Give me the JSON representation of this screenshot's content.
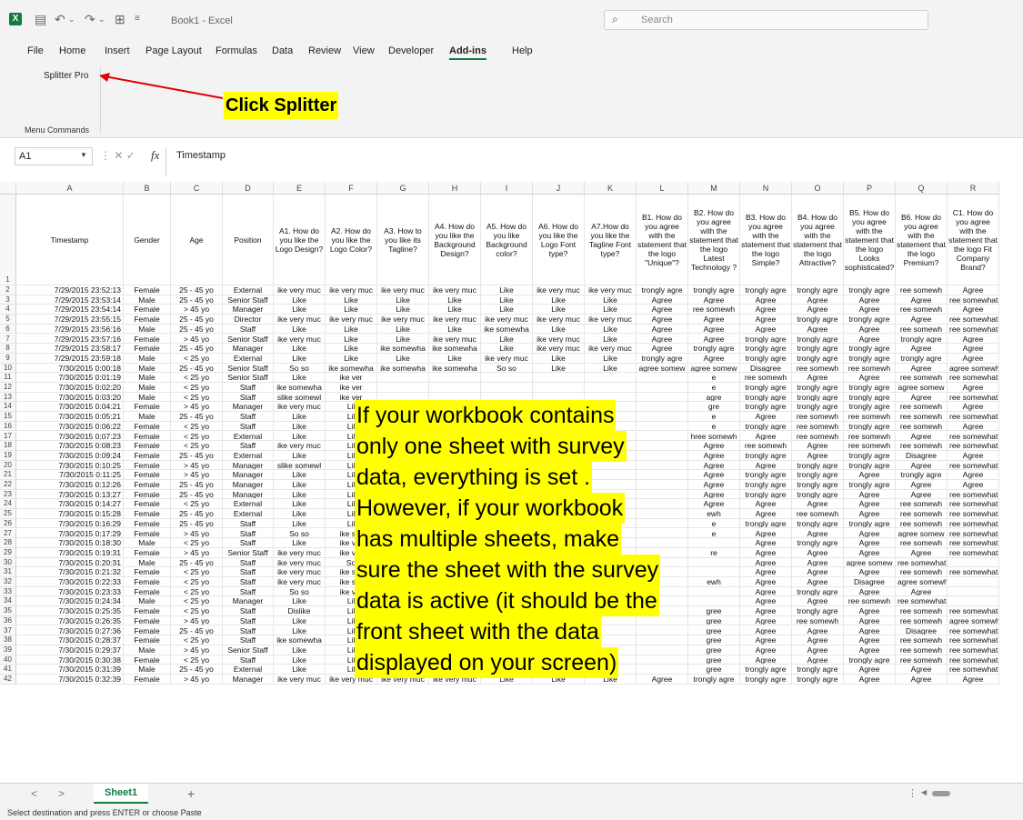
{
  "window": {
    "app_logo": "X",
    "title": "Book1 - Excel",
    "search_placeholder": "Search"
  },
  "menu": [
    "File",
    "Home",
    "Insert",
    "Page Layout",
    "Formulas",
    "Data",
    "Review",
    "View",
    "Developer",
    "Add-ins",
    "Help"
  ],
  "menu_active": "Add-ins",
  "ribbon": {
    "button": "Splitter Pro",
    "group": "Menu Commands"
  },
  "annotation": {
    "small": "Click Splitter",
    "big_lines": [
      "If your workbook contains",
      "only one sheet with survey",
      "data, everything is set .",
      "However, if your workbook",
      "has multiple sheets, make",
      "sure the sheet with the survey",
      "data is active (it should be the",
      "front sheet with the data",
      "displayed on your screen)"
    ]
  },
  "formula_bar": {
    "name_box": "A1",
    "fx": "fx",
    "content": "Timestamp"
  },
  "grid": {
    "columns": [
      "A",
      "B",
      "C",
      "D",
      "E",
      "F",
      "G",
      "H",
      "I",
      "J",
      "K",
      "L",
      "M",
      "N",
      "O",
      "P",
      "Q",
      "R"
    ],
    "header_row": [
      "Timestamp",
      "Gender",
      "Age",
      "Position",
      "A1. How do you like the Logo Design?",
      "A2. How do you like the Logo Color?",
      "A3. How to you like its Tagline?",
      "A4. How do you like the Background Design?",
      "A5. How do you like Background color?",
      "A6. How do you like the Logo Font type?",
      "A7.How do you like the Tagline Font type?",
      "B1. How do you agree with the statement that the logo \"Unique\"?",
      "B2. How do you agree with the statement that the logo Latest Technology ?",
      "B3. How do you agree with the statement that the logo Simple?",
      "B4. How do you agree with the statement that the logo Attractive?",
      "B5. How do you agree with the statement that the logo Looks sophisticated?",
      "B6. How do you agree with the statement that the logo Premium?",
      "C1. How do you agree with the statement that the logo Fit Company Brand?"
    ],
    "rows": [
      [
        "7/29/2015 23:52:13",
        "Female",
        "25 - 45 yo",
        "External",
        "ike very muc",
        "ike very muc",
        "ike very muc",
        "ike very muc",
        "Like",
        "ike very muc",
        "ike very muc",
        "trongly agre",
        "trongly agre",
        "trongly agre",
        "trongly agre",
        "trongly agre",
        "ree somewh",
        "Agree"
      ],
      [
        "7/29/2015 23:53:14",
        "Male",
        "25 - 45 yo",
        "Senior Staff",
        "Like",
        "Like",
        "Like",
        "Like",
        "Like",
        "Like",
        "Like",
        "Agree",
        "Agree",
        "Agree",
        "Agree",
        "Agree",
        "Agree",
        "ree somewhat"
      ],
      [
        "7/29/2015 23:54:14",
        "Female",
        "> 45 yo",
        "Manager",
        "Like",
        "Like",
        "Like",
        "Like",
        "Like",
        "Like",
        "Like",
        "Agree",
        "ree somewh",
        "Agree",
        "Agree",
        "Agree",
        "ree somewh",
        "Agree"
      ],
      [
        "7/29/2015 23:55:15",
        "Female",
        "25 - 45 yo",
        "Director",
        "ike very muc",
        "ike very muc",
        "ike very muc",
        "ike very muc",
        "ike very muc",
        "ike very muc",
        "ike very muc",
        "Agree",
        "Agree",
        "Agree",
        "trongly agre",
        "trongly agre",
        "Agree",
        "ree somewhat"
      ],
      [
        "7/29/2015 23:56:16",
        "Male",
        "25 - 45 yo",
        "Staff",
        "Like",
        "Like",
        "Like",
        "Like",
        "ike somewha",
        "Like",
        "Like",
        "Agree",
        "Agree",
        "Agree",
        "Agree",
        "Agree",
        "ree somewh",
        "ree somewhat"
      ],
      [
        "7/29/2015 23:57:16",
        "Female",
        "> 45 yo",
        "Senior Staff",
        "ike very muc",
        "Like",
        "Like",
        "ike very muc",
        "Like",
        "ike very muc",
        "Like",
        "Agree",
        "Agree",
        "trongly agre",
        "trongly agre",
        "Agree",
        "trongly agre",
        "Agree"
      ],
      [
        "7/29/2015 23:58:17",
        "Female",
        "25 - 45 yo",
        "Manager",
        "Like",
        "Like",
        "ike somewha",
        "ike somewha",
        "Like",
        "ike very muc",
        "ike very muc",
        "Agree",
        "trongly agre",
        "trongly agre",
        "trongly agre",
        "trongly agre",
        "Agree",
        "Agree"
      ],
      [
        "7/29/2015 23:59:18",
        "Male",
        "< 25 yo",
        "External",
        "Like",
        "Like",
        "Like",
        "Like",
        "ike very muc",
        "Like",
        "Like",
        "trongly agre",
        "Agree",
        "trongly agre",
        "trongly agre",
        "trongly agre",
        "trongly agre",
        "Agree"
      ],
      [
        "7/30/2015 0:00:18",
        "Male",
        "25 - 45 yo",
        "Senior Staff",
        "So so",
        "ike somewha",
        "ike somewha",
        "ike somewha",
        "So so",
        "Like",
        "Like",
        "agree somew",
        "agree somew",
        "Disagree",
        "ree somewh",
        "ree somewh",
        "Agree",
        "agree somewhat"
      ],
      [
        "7/30/2015 0:01:19",
        "Male",
        "< 25 yo",
        "Senior Staff",
        "Like",
        "ike ver",
        "",
        "",
        "",
        "",
        "",
        "",
        "e",
        "ree somewh",
        "Agree",
        "Agree",
        "ree somewh",
        "ree somewhat"
      ],
      [
        "7/30/2015 0:02:20",
        "Male",
        "< 25 yo",
        "Staff",
        "ike somewha",
        "ike ver",
        "",
        "",
        "",
        "",
        "",
        "",
        "e",
        "trongly agre",
        "trongly agre",
        "trongly agre",
        "agree somew",
        "Agree"
      ],
      [
        "7/30/2015 0:03:20",
        "Male",
        "< 25 yo",
        "Staff",
        "slike somewl",
        "ike ver",
        "",
        "",
        "",
        "",
        "",
        "",
        "agre",
        "trongly agre",
        "trongly agre",
        "trongly agre",
        "Agree",
        "ree somewhat"
      ],
      [
        "7/30/2015 0:04:21",
        "Female",
        "> 45 yo",
        "Manager",
        "ike very muc",
        "Lil",
        "",
        "",
        "",
        "",
        "",
        "",
        "gre",
        "trongly agre",
        "trongly agre",
        "trongly agre",
        "ree somewh",
        "Agree"
      ],
      [
        "7/30/2015 0:05:21",
        "Male",
        "25 - 45 yo",
        "Staff",
        "Like",
        "Lil",
        "",
        "",
        "",
        "",
        "",
        "",
        "e",
        "Agree",
        "ree somewh",
        "ree somewh",
        "ree somewh",
        "ree somewhat"
      ],
      [
        "7/30/2015 0:06:22",
        "Female",
        "< 25 yo",
        "Staff",
        "Like",
        "Lil",
        "",
        "",
        "",
        "",
        "",
        "",
        "e",
        "trongly agre",
        "ree somewh",
        "trongly agre",
        "ree somewh",
        "Agree"
      ],
      [
        "7/30/2015 0:07:23",
        "Female",
        "< 25 yo",
        "External",
        "Like",
        "Lil",
        "",
        "",
        "",
        "",
        "",
        "",
        "hree somewh",
        "Agree",
        "ree somewh",
        "ree somewh",
        "Agree",
        "ree somewhat"
      ],
      [
        "7/30/2015 0:08:23",
        "Female",
        "< 25 yo",
        "Staff",
        "ike very muc",
        "Lil",
        "",
        "",
        "",
        "",
        "",
        "",
        "Agree",
        "ree somewh",
        "Agree",
        "ree somewh",
        "ree somewh",
        "ree somewhat"
      ],
      [
        "7/30/2015 0:09:24",
        "Female",
        "25 - 45 yo",
        "External",
        "Like",
        "Lil",
        "",
        "",
        "",
        "",
        "",
        "",
        "Agree",
        "trongly agre",
        "Agree",
        "trongly agre",
        "Disagree",
        "Agree"
      ],
      [
        "7/30/2015 0:10:25",
        "Female",
        "> 45 yo",
        "Manager",
        "slike somewl",
        "Lil",
        "",
        "",
        "",
        "",
        "",
        "",
        "Agree",
        "Agree",
        "trongly agre",
        "trongly agre",
        "Agree",
        "ree somewhat"
      ],
      [
        "7/30/2015 0:11:25",
        "Female",
        "> 45 yo",
        "Manager",
        "Like",
        "Lil",
        "",
        "",
        "",
        "",
        "",
        "",
        "Agree",
        "trongly agre",
        "trongly agre",
        "Agree",
        "trongly agre",
        "Agree"
      ],
      [
        "7/30/2015 0:12:26",
        "Female",
        "25 - 45 yo",
        "Manager",
        "Like",
        "Lil",
        "",
        "",
        "",
        "",
        "",
        "",
        "Agree",
        "trongly agre",
        "trongly agre",
        "trongly agre",
        "Agree",
        "Agree"
      ],
      [
        "7/30/2015 0:13:27",
        "Female",
        "25 - 45 yo",
        "Manager",
        "Like",
        "Lil",
        "",
        "",
        "",
        "",
        "",
        "",
        "Agree",
        "trongly agre",
        "trongly agre",
        "Agree",
        "Agree",
        "ree somewhat"
      ],
      [
        "7/30/2015 0:14:27",
        "Female",
        "< 25 yo",
        "External",
        "Like",
        "Lil",
        "",
        "",
        "",
        "",
        "",
        "",
        "Agree",
        "Agree",
        "Agree",
        "Agree",
        "ree somewh",
        "ree somewhat"
      ],
      [
        "7/30/2015 0:15:28",
        "Female",
        "25 - 45 yo",
        "External",
        "Like",
        "Lil",
        "",
        "",
        "",
        "",
        "",
        "",
        "ewh",
        "Agree",
        "ree somewh",
        "Agree",
        "ree somewh",
        "ree somewhat"
      ],
      [
        "7/30/2015 0:16:29",
        "Female",
        "25 - 45 yo",
        "Staff",
        "Like",
        "Lil",
        "",
        "",
        "",
        "",
        "",
        "",
        "e",
        "trongly agre",
        "trongly agre",
        "trongly agre",
        "ree somewh",
        "ree somewhat"
      ],
      [
        "7/30/2015 0:17:29",
        "Female",
        "> 45 yo",
        "Staff",
        "So so",
        "ike sor",
        "",
        "",
        "",
        "",
        "",
        "",
        "e",
        "Agree",
        "Agree",
        "Agree",
        "agree somew",
        "ree somewhat"
      ],
      [
        "7/30/2015 0:18:30",
        "Male",
        "< 25 yo",
        "Staff",
        "Like",
        "ike ver",
        "",
        "",
        "",
        "",
        "",
        "",
        "",
        "Agree",
        "trongly agre",
        "Agree",
        "ree somewh",
        "ree somewhat"
      ],
      [
        "7/30/2015 0:19:31",
        "Female",
        "> 45 yo",
        "Senior Staff",
        "ike very muc",
        "ike ver",
        "",
        "",
        "",
        "",
        "",
        "",
        "re",
        "Agree",
        "Agree",
        "Agree",
        "Agree",
        "ree somewhat"
      ],
      [
        "7/30/2015 0:20:31",
        "Male",
        "25 - 45 yo",
        "Staff",
        "ike very muc",
        "So",
        "",
        "",
        "",
        "",
        "",
        "",
        "",
        "Agree",
        "Agree",
        "agree somew",
        "ree somewhat",
        ""
      ],
      [
        "7/30/2015 0:21:32",
        "Female",
        "< 25 yo",
        "Staff",
        "ike very muc",
        "ike sor",
        "",
        "",
        "",
        "",
        "",
        "",
        "",
        "Agree",
        "Agree",
        "Agree",
        "ree somewh",
        "ree somewhat"
      ],
      [
        "7/30/2015 0:22:33",
        "Female",
        "< 25 yo",
        "Staff",
        "ike very muc",
        "ike sor",
        "",
        "",
        "",
        "",
        "",
        "",
        "ewh",
        "Agree",
        "Agree",
        "Disagree",
        "agree somewhat",
        ""
      ],
      [
        "7/30/2015 0:23:33",
        "Female",
        "< 25 yo",
        "Staff",
        "So so",
        "ike ver",
        "",
        "",
        "",
        "",
        "",
        "",
        "",
        "Agree",
        "trongly agre",
        "Agree",
        "Agree",
        ""
      ],
      [
        "7/30/2015 0:24:34",
        "Male",
        "< 25 yo",
        "Manager",
        "Like",
        "Lil",
        "",
        "",
        "",
        "",
        "",
        "",
        "",
        "Agree",
        "Agree",
        "ree somewh",
        "ree somewhat",
        ""
      ],
      [
        "7/30/2015 0:25:35",
        "Female",
        "< 25 yo",
        "Staff",
        "Dislike",
        "Lil",
        "",
        "",
        "",
        "",
        "",
        "",
        "gree",
        "Agree",
        "trongly agre",
        "Agree",
        "ree somewh",
        "ree somewhat"
      ],
      [
        "7/30/2015 0:26:35",
        "Female",
        "> 45 yo",
        "Staff",
        "Like",
        "Lil",
        "",
        "",
        "",
        "",
        "",
        "",
        "gree",
        "Agree",
        "ree somewh",
        "Agree",
        "ree somewh",
        "agree somewhat"
      ],
      [
        "7/30/2015 0:27:36",
        "Female",
        "25 - 45 yo",
        "Staff",
        "Like",
        "Lil",
        "",
        "",
        "",
        "",
        "",
        "",
        "gree",
        "Agree",
        "Agree",
        "Agree",
        "Disagree",
        "ree somewhat"
      ],
      [
        "7/30/2015 0:28:37",
        "Female",
        "< 25 yo",
        "Staff",
        "ike somewha",
        "Lil",
        "",
        "",
        "",
        "",
        "",
        "",
        "gree",
        "Agree",
        "Agree",
        "Agree",
        "ree somewh",
        "ree somewhat"
      ],
      [
        "7/30/2015 0:29:37",
        "Male",
        "> 45 yo",
        "Senior Staff",
        "Like",
        "Lil",
        "",
        "",
        "",
        "",
        "",
        "",
        "gree",
        "Agree",
        "Agree",
        "Agree",
        "ree somewh",
        "ree somewhat"
      ],
      [
        "7/30/2015 0:30:38",
        "Female",
        "< 25 yo",
        "Staff",
        "Like",
        "Lil",
        "",
        "",
        "",
        "",
        "",
        "",
        "gree",
        "Agree",
        "Agree",
        "trongly agre",
        "ree somewh",
        "ree somewhat"
      ],
      [
        "7/30/2015 0:31:39",
        "Male",
        "25 - 45 yo",
        "External",
        "Like",
        "Lil",
        "",
        "",
        "",
        "",
        "",
        "",
        "gree",
        "trongly agre",
        "trongly agre",
        "Agree",
        "Agree",
        "ree somewhat"
      ],
      [
        "7/30/2015 0:32:39",
        "Female",
        "> 45 yo",
        "Manager",
        "ike very muc",
        "ike very muc",
        "ike very muc",
        "ike very muc",
        "Like",
        "Like",
        "Like",
        "Agree",
        "trongly agre",
        "trongly agre",
        "trongly agre",
        "Agree",
        "Agree",
        "Agree"
      ]
    ]
  },
  "sheets": {
    "active": "Sheet1",
    "add": "+",
    "nav_prev": "<",
    "nav_next": ">",
    "more": "⋮",
    "scroll_left": "◀"
  },
  "status": "Select destination and press ENTER or choose Paste"
}
